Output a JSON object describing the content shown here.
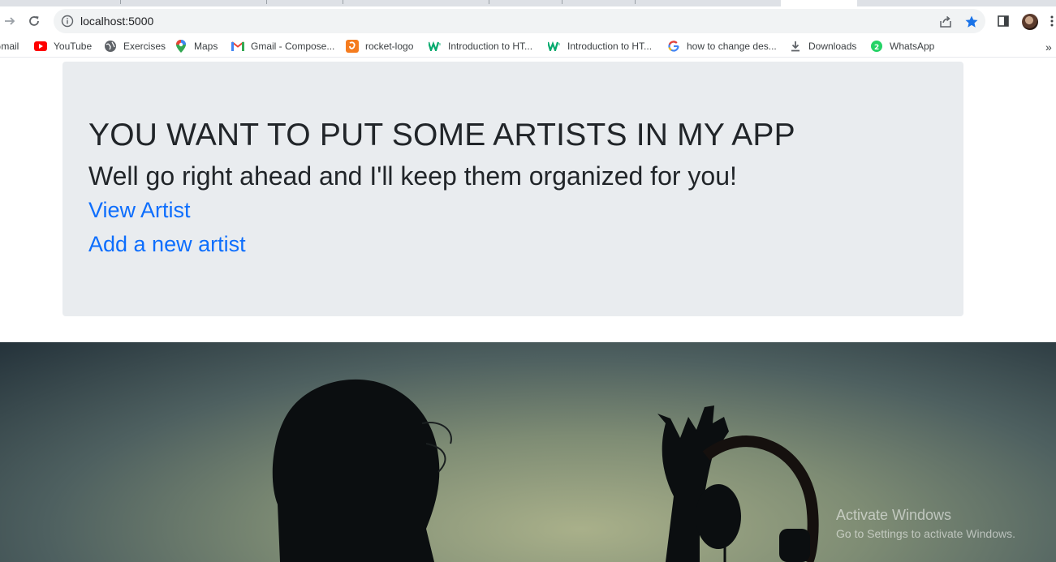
{
  "browser": {
    "url": "localhost:5000",
    "bookmarks": [
      {
        "label": "Gmail",
        "icon": "gmail-icon"
      },
      {
        "label": "YouTube",
        "icon": "youtube-icon"
      },
      {
        "label": "Exercises",
        "icon": "globe-icon"
      },
      {
        "label": "Maps",
        "icon": "maps-pin-icon"
      },
      {
        "label": "Gmail - Compose...",
        "icon": "gmail-icon"
      },
      {
        "label": "rocket-logo",
        "icon": "orange-app-icon"
      },
      {
        "label": "Introduction to HT...",
        "icon": "w3-icon"
      },
      {
        "label": "Introduction to HT...",
        "icon": "w3-icon"
      },
      {
        "label": "how to change des...",
        "icon": "google-icon"
      },
      {
        "label": "Downloads",
        "icon": "download-icon"
      },
      {
        "label": "WhatsApp",
        "icon": "whatsapp-icon"
      }
    ],
    "more_label": "»",
    "accent_color": "#1a73e8"
  },
  "page": {
    "heading": "YOU WANT TO PUT SOME ARTISTS IN MY APP",
    "subheading": "Well go right ahead and I'll keep them organized for you!",
    "link_view": "View Artist",
    "link_add": "Add a new artist"
  },
  "watermark": {
    "title": "Activate Windows",
    "subtitle": "Go to Settings to activate Windows."
  }
}
